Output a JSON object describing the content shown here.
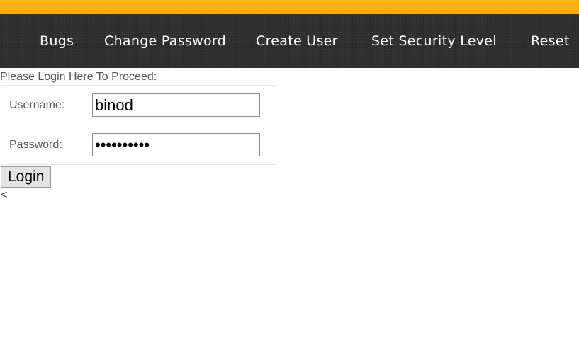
{
  "nav": {
    "items": [
      {
        "label": "Bugs"
      },
      {
        "label": "Change Password"
      },
      {
        "label": "Create User"
      },
      {
        "label": "Set Security Level"
      },
      {
        "label": "Reset"
      }
    ]
  },
  "login": {
    "prompt": "Please Login Here To Proceed:",
    "username_label": "Username:",
    "username_value": "binod",
    "password_label": "Password:",
    "password_value": "••••••••••",
    "login_button": "Login"
  },
  "trailer_text": "<",
  "colors": {
    "top_stripe": "#fcb514",
    "navbar_bg": "#2e2e2e",
    "nav_text": "#ffffff"
  }
}
